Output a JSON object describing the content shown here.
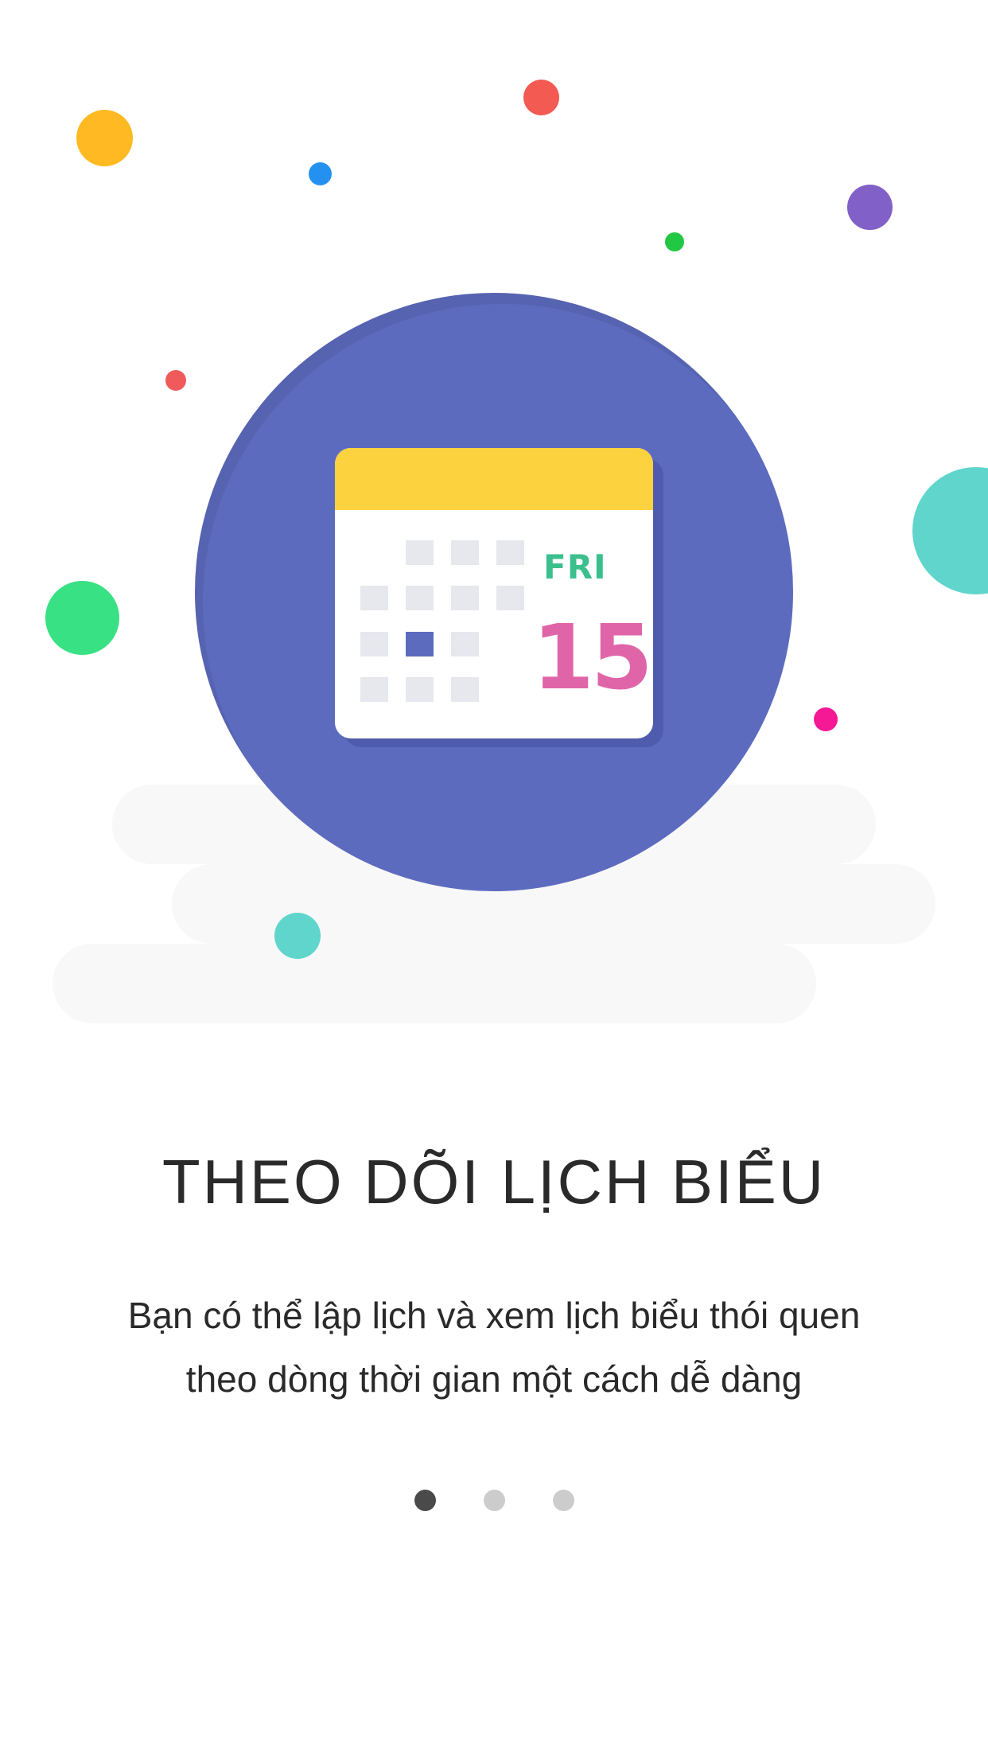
{
  "colors": {
    "background": "#ffffff",
    "circle": "#5d6bbf",
    "calendar_header": "#fcd23f",
    "day_label": "#3cbf8e",
    "date_number": "#e065a8",
    "text": "#2a2a2a",
    "pager_active": "#4a4a4a",
    "pager_inactive": "#cccccc"
  },
  "confetti_colors": [
    "#ffba23",
    "#2491f0",
    "#f25a52",
    "#22c744",
    "#8160c8",
    "#f05a5a",
    "#5fd5cb",
    "#38e183",
    "#f51996",
    "#5fd5cb"
  ],
  "illustration": {
    "icon": "calendar-icon",
    "day": "FRI",
    "date": "15",
    "selected_cell": 1
  },
  "onboarding": {
    "title": "THEO DÕI LỊCH BIỂU",
    "description": "Bạn có thể lập lịch và xem lịch biểu thói quen theo dòng thời gian một cách dễ dàng",
    "page_count": 3,
    "active_page": 1
  }
}
